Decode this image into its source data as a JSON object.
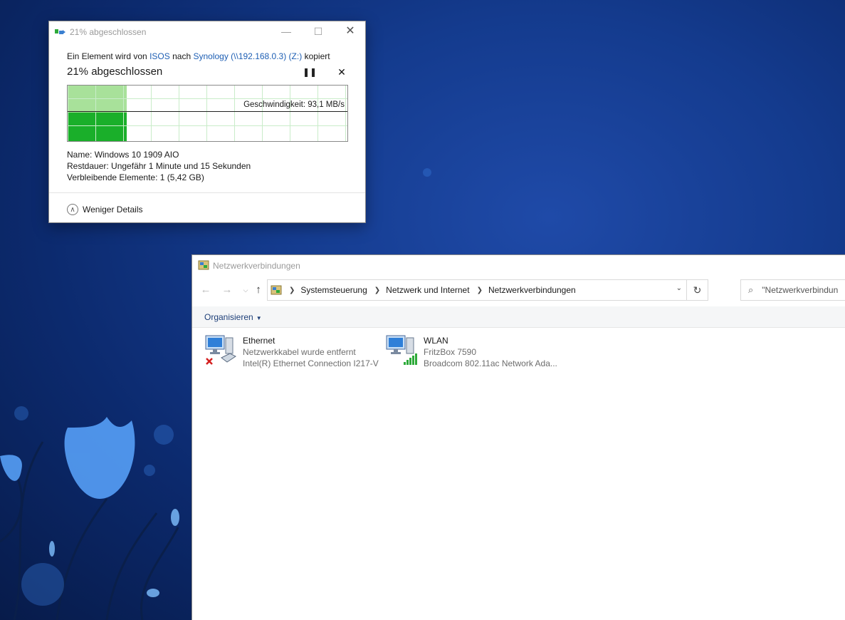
{
  "copy_dialog": {
    "window_title": "21% abgeschlossen",
    "line_prefix": "Ein Element wird von",
    "source": "ISOS",
    "line_mid": "nach",
    "destination": "Synology (\\\\192.168.0.3) (Z:)",
    "line_suffix": "kopiert",
    "percent_label": "21% abgeschlossen",
    "progress_fraction": 0.21,
    "speed_label": "Geschwindigkeit: 93,1 MB/s",
    "details": {
      "name_label": "Name:",
      "name_value": "Windows 10 1909 AIO",
      "remaining_label": "Restdauer:",
      "remaining_value": "Ungefähr 1 Minute und 15 Sekunden",
      "items_label": "Verbleibende Elemente:",
      "items_value": "1 (5,42 GB)"
    },
    "less_details": "Weniger Details"
  },
  "network_window": {
    "window_title": "Netzwerkverbindungen",
    "breadcrumbs": [
      "Systemsteuerung",
      "Netzwerk und Internet",
      "Netzwerkverbindungen"
    ],
    "search_placeholder": "\"Netzwerkverbindun",
    "organize_label": "Organisieren",
    "adapters": [
      {
        "name": "Ethernet",
        "status": "Netzwerkkabel wurde entfernt",
        "device": "Intel(R) Ethernet Connection I217-V"
      },
      {
        "name": "WLAN",
        "status": "FritzBox 7590",
        "device": "Broadcom 802.11ac Network Ada..."
      }
    ]
  },
  "colors": {
    "progress_light": "#a8e19a",
    "progress_dark": "#1aaf2a",
    "link": "#1e5fb4",
    "error_red": "#d42020"
  }
}
